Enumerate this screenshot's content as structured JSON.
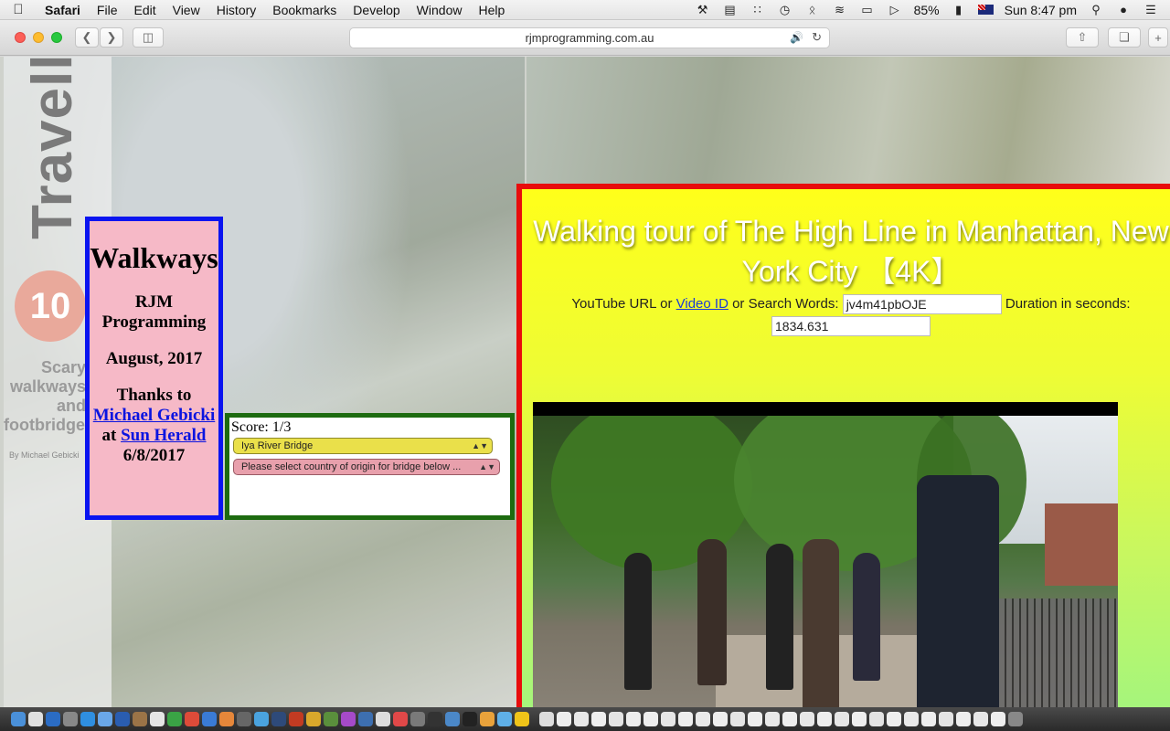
{
  "menubar": {
    "apple": "",
    "app_name": "Safari",
    "menus": [
      "File",
      "Edit",
      "View",
      "History",
      "Bookmarks",
      "Develop",
      "Window",
      "Help"
    ],
    "battery": "85%",
    "clock": "Sun 8:47 pm"
  },
  "browser": {
    "url": "rjmprogramming.com.au"
  },
  "background": {
    "travel_heading": "Travelle",
    "number": "10",
    "caption": "Scary walkways and footbridges",
    "byline": "By Michael Gebicki"
  },
  "info_panel": {
    "title": "Walkways",
    "org": "RJM Programming",
    "date": "August, 2017",
    "thanks": "Thanks to",
    "person_link": "Michael Gebicki",
    "at": "at",
    "paper_link": "Sun Herald",
    "pub_date": "6/8/2017"
  },
  "score_panel": {
    "score": "Score: 1/3",
    "bridge_selected": "Iya River Bridge",
    "country_selected": "Please select country of origin for bridge below ..."
  },
  "video_panel": {
    "title": "Walking tour of The High Line in Manhattan, New York City 【4K】",
    "url_label_1": "YouTube URL or ",
    "video_id_link": "Video ID",
    "url_label_2": " or Search Words: ",
    "video_id_value": "jv4m41pbOJE",
    "duration_label": "Duration in seconds:",
    "duration_value": "1834.631"
  },
  "colors": {
    "info_border": "#0a14f0",
    "info_bg": "#f6b9c7",
    "score_border": "#1d6b10",
    "video_border": "#e80c0c",
    "video_bg_top": "#ffff1a",
    "video_bg_bottom": "#a5f57c"
  }
}
